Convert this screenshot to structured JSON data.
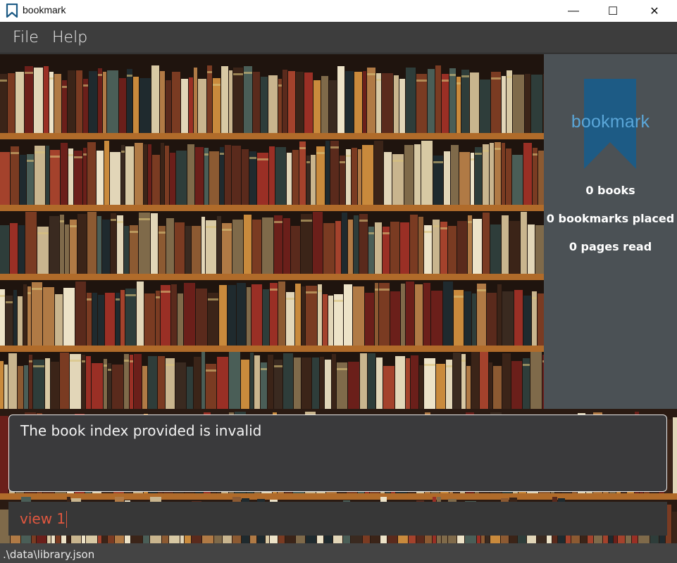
{
  "window": {
    "title": "bookmark",
    "minimize": "—",
    "maximize": "☐",
    "close": "✕"
  },
  "menu": {
    "file": "File",
    "help": "Help"
  },
  "sidebar": {
    "logo_text": "bookmark",
    "books": "0 books",
    "bookmarks_placed": "0 bookmarks placed",
    "pages_read": "0 pages read"
  },
  "result": {
    "message": "The book index provided is invalid"
  },
  "command": {
    "value": "view 1"
  },
  "status": {
    "file_path": ".\\data\\library.json"
  },
  "colors": {
    "accent": "#5aa6d8",
    "logo_fill": "#1d5b85",
    "command_text": "#e0573f",
    "sidebar_bg": "#4b5155",
    "menubar_bg": "#3d3d3d"
  }
}
